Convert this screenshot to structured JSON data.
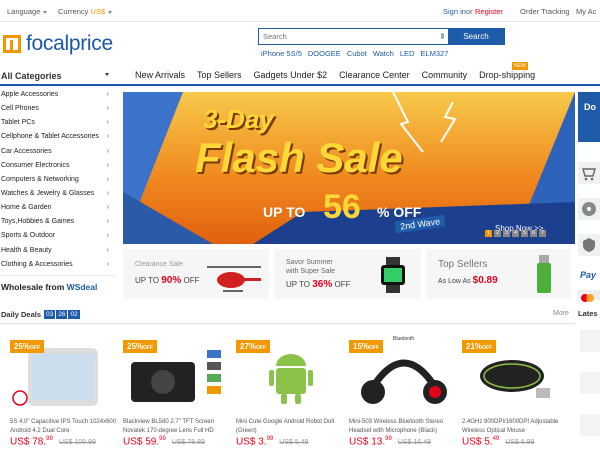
{
  "topbar": {
    "language": "Language",
    "currency_label": "Currency",
    "currency_value": "US$",
    "sign_in": "Sign in",
    "or": "or",
    "register": "Register",
    "order_tracking": "Order Tracking",
    "my_account": "My Ac"
  },
  "brand": {
    "name": "focalprice",
    "color": "#1a5aa8",
    "accent": "#f39800"
  },
  "search": {
    "placeholder": "Search",
    "button": "Search",
    "hot_words": [
      "iPhone 5S/5",
      "DOOGEE",
      "Cubot",
      "Watch",
      "LED",
      "ELM327"
    ]
  },
  "nav": {
    "all_categories": "All Categories",
    "items": [
      "New Arrivals",
      "Top Sellers",
      "Gadgets Under $2",
      "Clearance Center",
      "Community",
      "Drop-shipping"
    ],
    "new_badge": "NEW"
  },
  "sidebar": {
    "categories": [
      "Apple Accessories",
      "Cell Phones",
      "Tablet PCs",
      "Cellphone & Tablet Accessories",
      "Car Accessories",
      "Consumer Electronics",
      "Computers & Networking",
      "Watches & Jewelry & Glasses",
      "Home & Garden",
      "Toys,Hobbies & Games",
      "Sports & Outdoor",
      "Health & Beauty",
      "Clothing & Accessories"
    ],
    "wholesale_prefix": "Wholesale from",
    "wholesale_brand": "WSdeal"
  },
  "banner": {
    "line1": "3-Day",
    "line2": "Flash Sale",
    "up_to": "UP TO",
    "percent": "56",
    "off": "% OFF",
    "wave": "2nd Wave",
    "shop_now": "Shop Now >>",
    "pages": [
      "1",
      "2",
      "3",
      "4",
      "5",
      "6",
      "7"
    ],
    "side_text": "Do"
  },
  "promos": {
    "clearance_title": "Clearance Sale",
    "clearance_up_to": "UP TO",
    "clearance_percent": "90%",
    "clearance_off": "OFF",
    "summer_title": "Savor Summer",
    "summer_sub": "with Super Sale",
    "summer_up_to": "UP TO",
    "summer_percent": "36%",
    "summer_off": "OFF",
    "sellers_title": "Top Sellers",
    "sellers_as_low": "As Low As",
    "sellers_price": "$0.89",
    "pay": "Pay"
  },
  "deals": {
    "title": "Daily Deals",
    "timer": [
      "03",
      "26",
      "02"
    ],
    "more": "More",
    "latest": "Lates",
    "off_label": "OFF"
  },
  "products": [
    {
      "pct": "25%",
      "name": "5S 4.0\" Capacitive IPS Touch 1024x600 Android 4.2 Dual Core",
      "price_int": "US$ 78.",
      "price_dec": "99",
      "old": "US$ 105.99"
    },
    {
      "pct": "25%",
      "name": "Blackview BL580 2.7\" TFT Screen Novatek 170-degree Lens Full HD",
      "price_int": "US$ 59.",
      "price_dec": "99",
      "old": "US$ 79.89"
    },
    {
      "pct": "27%",
      "name": "Mini Cute Google Android Robot Doll (Green)",
      "price_int": "US$ 3.",
      "price_dec": "99",
      "old": "US$ 5.49"
    },
    {
      "pct": "15%",
      "name": "Mini-503 Wireless Bluetooth Stereo Headset with Microphone (Black)",
      "price_int": "US$ 13.",
      "price_dec": "99",
      "old": "US$ 16.49",
      "badge": "Bluetooth"
    },
    {
      "pct": "21%",
      "name": "2.4GHz 800DPI/1600DPI Adjustable Wireless Optical Mouse",
      "price_int": "US$ 5.",
      "price_dec": "49",
      "old": "US$ 6.99"
    }
  ]
}
